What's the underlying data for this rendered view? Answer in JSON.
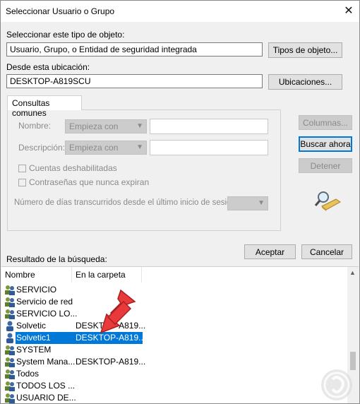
{
  "window": {
    "title": "Seleccionar Usuario o Grupo"
  },
  "object_type": {
    "label": "Seleccionar este tipo de objeto:",
    "value": "Usuario, Grupo, o Entidad de seguridad integrada",
    "button": "Tipos de objeto..."
  },
  "location": {
    "label": "Desde esta ubicación:",
    "value": "DESKTOP-A819SCU",
    "button": "Ubicaciones..."
  },
  "common_queries": {
    "tab": "Consultas comunes",
    "name_label": "Nombre:",
    "name_mode": "Empieza con",
    "desc_label": "Descripción:",
    "desc_mode": "Empieza con",
    "disabled_accounts": "Cuentas deshabilitadas",
    "non_expiring": "Contraseñas que nunca expiran",
    "days_label": "Número de días transcurridos desde el último inicio de sesión:"
  },
  "side_buttons": {
    "columns": "Columnas...",
    "search": "Buscar ahora",
    "stop": "Detener"
  },
  "footer": {
    "accept": "Aceptar",
    "cancel": "Cancelar",
    "results_label": "Resultado de la búsqueda:"
  },
  "results": {
    "columns": [
      "Nombre",
      "En la carpeta"
    ],
    "rows": [
      {
        "name": "SERVICIO",
        "folder": "",
        "icon": "group-icon"
      },
      {
        "name": "Servicio de red",
        "folder": "",
        "icon": "group-icon"
      },
      {
        "name": "SERVICIO LO...",
        "folder": "",
        "icon": "group-icon"
      },
      {
        "name": "Solvetic",
        "folder": "DESKTOP-A819...",
        "icon": "user-icon"
      },
      {
        "name": "Solvetic1",
        "folder": "DESKTOP-A819...",
        "icon": "user-icon",
        "selected": true
      },
      {
        "name": "SYSTEM",
        "folder": "",
        "icon": "group-icon"
      },
      {
        "name": "System Mana...",
        "folder": "DESKTOP-A819...",
        "icon": "group-icon"
      },
      {
        "name": "Todos",
        "folder": "",
        "icon": "group-icon"
      },
      {
        "name": "TODOS LOS ...",
        "folder": "",
        "icon": "group-icon"
      },
      {
        "name": "USUARIO DE...",
        "folder": "",
        "icon": "group-icon"
      }
    ]
  },
  "colors": {
    "selection": "#0078d7",
    "arrow": "#e83a3a"
  }
}
